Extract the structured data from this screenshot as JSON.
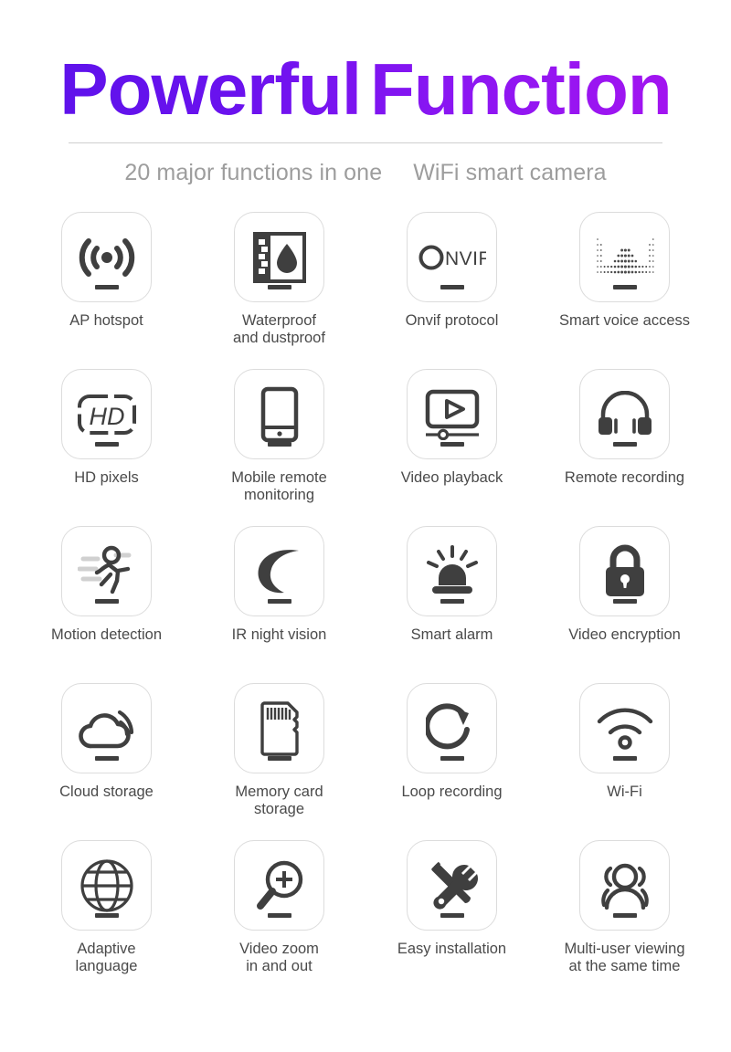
{
  "header": {
    "title_part1": "Powerful",
    "title_part2": "Function",
    "subtitle_left": "20 major functions in one",
    "subtitle_right": "WiFi smart camera",
    "title_gradient_start": "#5b12ea",
    "title_gradient_end": "#a914f0",
    "subtitle_color": "#9d9d9d",
    "divider_color": "#cfcfcf"
  },
  "style": {
    "card_border_color": "#dcdcdc",
    "icon_color": "#3f3f3f",
    "label_color": "#4a4a4a",
    "background": "#ffffff"
  },
  "features": [
    {
      "label": "AP hotspot",
      "icon": "ap-hotspot-icon"
    },
    {
      "label": "Waterproof\nand dustproof",
      "icon": "waterproof-dustproof-icon"
    },
    {
      "label": "Onvif protocol",
      "icon": "onvif-logo-icon"
    },
    {
      "label": "Smart voice access",
      "icon": "voice-waveform-icon"
    },
    {
      "label": "HD pixels",
      "icon": "hd-pixels-icon"
    },
    {
      "label": "Mobile remote\nmonitoring",
      "icon": "mobile-phone-icon"
    },
    {
      "label": "Video playback",
      "icon": "video-playback-icon"
    },
    {
      "label": "Remote recording",
      "icon": "headphones-icon"
    },
    {
      "label": "Motion detection",
      "icon": "running-person-icon"
    },
    {
      "label": "IR night vision",
      "icon": "crescent-moon-icon"
    },
    {
      "label": "Smart alarm",
      "icon": "siren-alarm-icon"
    },
    {
      "label": "Video encryption",
      "icon": "padlock-icon"
    },
    {
      "label": "Cloud storage",
      "icon": "cloud-upload-icon"
    },
    {
      "label": "Memory card\nstorage",
      "icon": "sd-card-icon"
    },
    {
      "label": "Loop recording",
      "icon": "loop-arrow-icon"
    },
    {
      "label": "Wi-Fi",
      "icon": "wifi-signal-icon"
    },
    {
      "label": "Adaptive\nlanguage",
      "icon": "globe-icon"
    },
    {
      "label": "Video zoom\nin and out",
      "icon": "magnifier-plus-icon"
    },
    {
      "label": "Easy installation",
      "icon": "wrench-screwdriver-icon"
    },
    {
      "label": "Multi-user viewing\nat the same time",
      "icon": "users-group-icon"
    }
  ]
}
